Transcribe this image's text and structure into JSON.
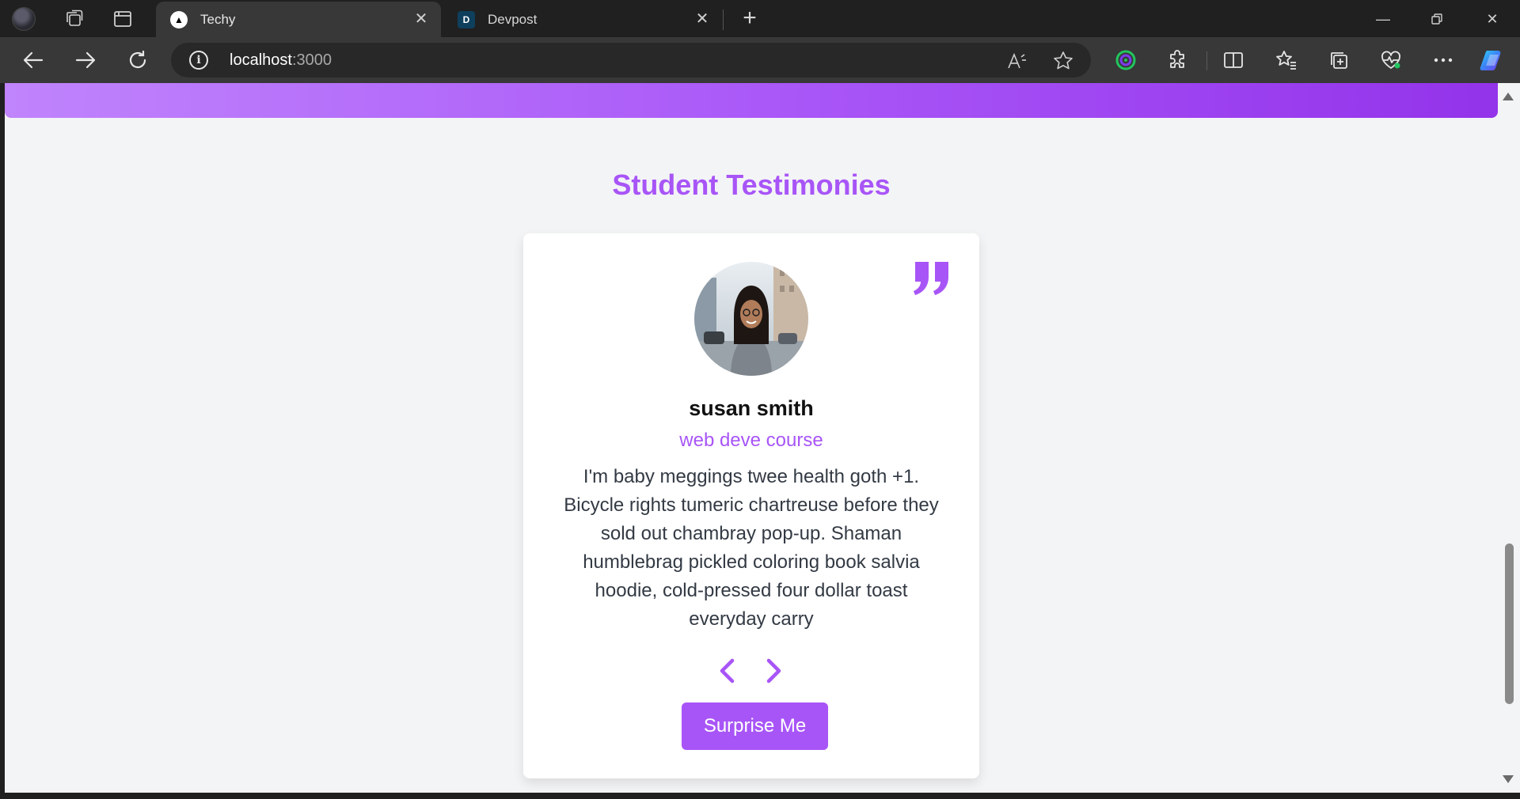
{
  "browser": {
    "tabs": [
      {
        "title": "Techy",
        "favicon": "▲",
        "active": true
      },
      {
        "title": "Devpost",
        "favicon": "D",
        "active": false
      }
    ],
    "url": {
      "host": "localhost",
      "port": ":3000"
    },
    "icons": {
      "profile": "profile-avatar-icon",
      "workspaces": "workspaces-icon",
      "tab_actions": "tab-actions-icon",
      "new_tab": "plus-icon",
      "back": "back-arrow-icon",
      "forward": "forward-arrow-icon",
      "refresh": "refresh-icon",
      "site_info": "info-icon",
      "read_aloud": "read-aloud-icon",
      "favorite": "star-icon",
      "toolbar": [
        "vpn-ring-icon",
        "extensions-icon",
        "split-screen-icon",
        "favorites-icon",
        "collections-icon",
        "browser-health-icon",
        "more-icon",
        "copilot-icon"
      ]
    }
  },
  "page": {
    "heading": "Student Testimonies",
    "testimonial": {
      "name": "susan smith",
      "job": "web deve course",
      "text": "I'm baby meggings twee health goth +1. Bicycle rights tumeric chartreuse before they sold out chambray pop-up. Shaman humblebrag pickled coloring book salvia hoodie, cold-pressed four dollar toast everyday carry"
    },
    "surprise_label": "Surprise Me",
    "colors": {
      "accent": "#a855f7",
      "background": "#f3f4f6",
      "card": "#ffffff",
      "band_start": "#c084fc",
      "band_end": "#9333ea"
    }
  }
}
